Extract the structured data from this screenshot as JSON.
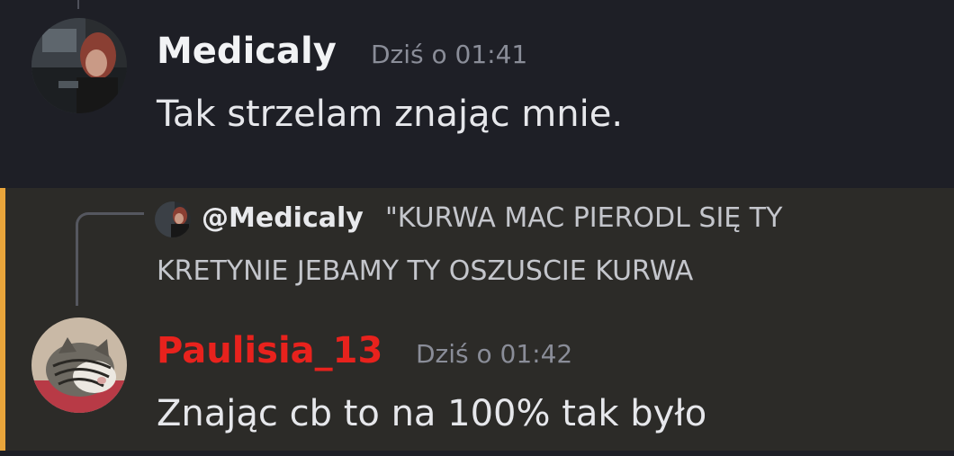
{
  "messages": [
    {
      "author": "Medicaly",
      "author_color": "#f2f3f5",
      "timestamp": "Dziś o 01:41",
      "content": "Tak strzelam znając mnie.",
      "avatar_icon": "user-photo-avatar"
    },
    {
      "author": "Paulisia_13",
      "author_color": "#e8221d",
      "timestamp": "Dziś o 01:42",
      "content": "Znając cb to na 100% tak było",
      "avatar_icon": "cat-photo-avatar",
      "mentioned": true,
      "reply": {
        "author": "@Medicaly",
        "text_line1": "\"KURWA MAC PIERODL SIĘ TY",
        "text_line2": "KRETYNIE JEBAMY TY OSZUSCIE KURWA"
      }
    }
  ],
  "colors": {
    "background": "#1e1f26",
    "mention_background": "#2c2b28",
    "mention_bar": "#e9a53b",
    "timestamp": "#8a8d98",
    "message_text": "#e6e7eb"
  }
}
